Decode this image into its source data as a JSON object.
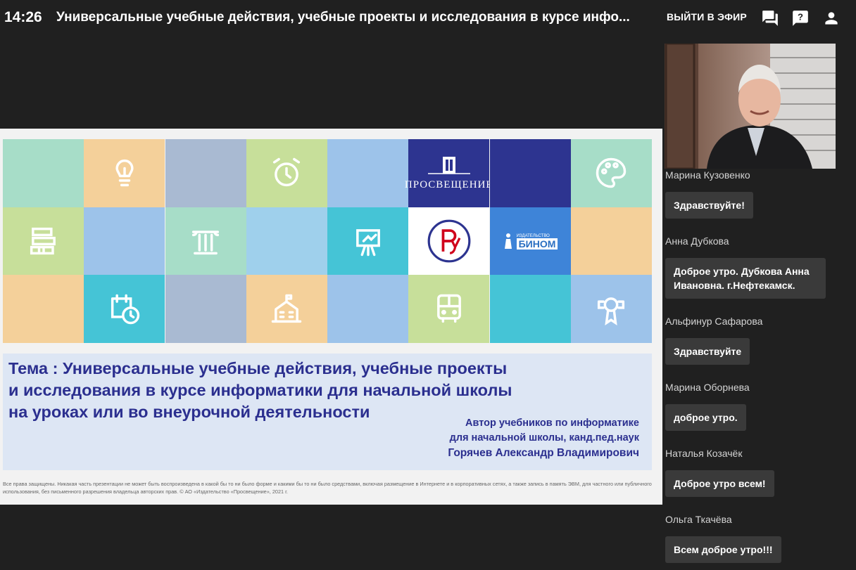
{
  "header": {
    "time": "14:26",
    "title": "Универсальные учебные действия, учебные проекты и исследования в курсе инфо...",
    "exit_label": "ВЫЙТИ В ЭФИР"
  },
  "slide": {
    "logos": {
      "prosv": "ПРОСВЕЩЕНИЕ",
      "binom_small": "ИЗДАТЕЛЬСТВО",
      "binom": "БИНОМ"
    },
    "theme_lines": [
      "Тема : Универсальные учебные действия, учебные проекты",
      "и исследования в курсе информатики для начальной школы",
      "на уроках или во внеурочной деятельности"
    ],
    "author_lines": [
      "Автор учебников по информатике",
      "для начальной школы, канд.пед.наук",
      "Горячев Александр Владимирович"
    ],
    "copyright": "Все права защищены. Никакая часть презентации не может быть воспроизведена в какой бы то ни было форме и какими бы то ни было средствами, включая размещение в Интернете и в корпоративных сетях, а также запись в память ЭВМ, для частного или публичного использования, без письменного разрешения владельца авторских прав. © АО «Издательство «Просвещение», 2021 г."
  },
  "chat": {
    "messages": [
      {
        "name": "Марина Кузовенко",
        "text": "Здравствуйте!"
      },
      {
        "name": "Анна Дубкова",
        "text": "Доброе утро.  Дубкова Анна Ивановна. г.Нефтекамск."
      },
      {
        "name": "Альфинур Сафарова",
        "text": "Здравствуйте"
      },
      {
        "name": "Марина Оборнева",
        "text": "доброе утро."
      },
      {
        "name": "Наталья Козачёк",
        "text": "Доброе утро всем!"
      },
      {
        "name": "Ольга Ткачёва",
        "text": "Всем  доброе утро!!!"
      }
    ]
  },
  "colors": {
    "background": "#202020",
    "bubble": "#3a3a3a",
    "slide_text": "#2b2f8f",
    "prosv_blue": "#2d3490"
  }
}
